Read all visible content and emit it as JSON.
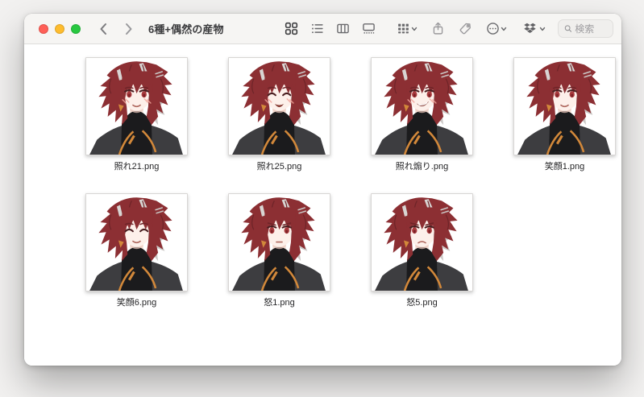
{
  "window": {
    "title": "6種+偶然の産物"
  },
  "toolbar": {
    "search_placeholder": "検索",
    "icons": {
      "traffic": [
        "close",
        "minimize",
        "zoom"
      ],
      "nav": [
        "chevron-left",
        "chevron-right"
      ],
      "views": [
        "icon-view",
        "list-view",
        "column-view",
        "gallery-view"
      ],
      "actions": [
        "group-by",
        "share",
        "tags",
        "more-actions"
      ],
      "cloud": "dropbox",
      "search": "magnifier"
    },
    "active_view": "icon-view"
  },
  "colors": {
    "traffic_red": "#ff5f57",
    "traffic_yellow": "#febc2e",
    "traffic_green": "#28c840",
    "toolbar_bg": "#f6f5f3",
    "icon_gray": "#69696c",
    "icon_active": "#3e3e40"
  },
  "portrait": {
    "hair": "#8c2f33",
    "hair_dark": "#6e2428",
    "silver": "#cbc8c6",
    "silver_light": "#d8d5d3",
    "skin": "#fdf0ea",
    "skin_shadow": "#ecc9bd",
    "eye": "#a93a3e",
    "lash": "#4a1f21",
    "jacket": "#3d3d40",
    "jacket_dark": "#2c2c2e",
    "shirt": "#1b1b1d",
    "orange": "#d2883a",
    "blush": "#f0a49a",
    "mouth": "#b06a60",
    "mouth_open": "#8a4038"
  },
  "files": [
    {
      "name": "照れ21.png",
      "eyes": "open",
      "mouth": "smile",
      "blush": true
    },
    {
      "name": "照れ25.png",
      "eyes": "closed",
      "mouth": "grin",
      "blush": true
    },
    {
      "name": "照れ煽り.png",
      "eyes": "open",
      "mouth": "smug",
      "blush": true
    },
    {
      "name": "笑顔1.png",
      "eyes": "open",
      "mouth": "smile",
      "blush": false
    },
    {
      "name": "笑顔6.png",
      "eyes": "closed",
      "mouth": "smile",
      "blush": false
    },
    {
      "name": "怒1.png",
      "eyes": "open",
      "mouth": "neutral",
      "blush": false
    },
    {
      "name": "怒5.png",
      "eyes": "open",
      "mouth": "frown",
      "blush": false
    }
  ]
}
